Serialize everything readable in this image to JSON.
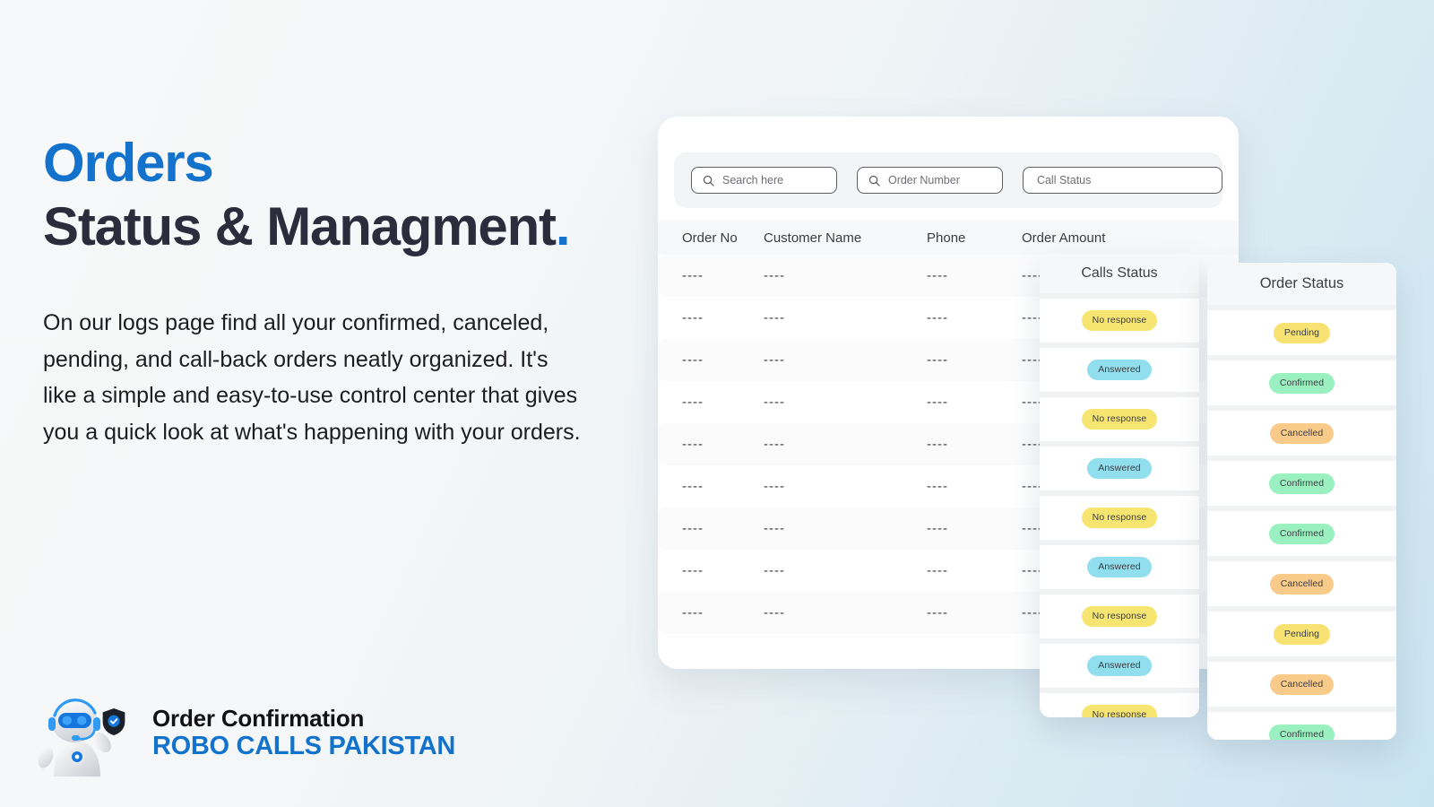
{
  "hero": {
    "headline_line1": "Orders",
    "headline_line2": "Status & Managment",
    "headline_dot": ".",
    "paragraph": "On our logs page find all your confirmed, canceled, pending, and call-back orders neatly organized. It's like a simple and easy-to-use control center that gives you a quick look at what's happening with your orders."
  },
  "brand": {
    "title": "Order Confirmation",
    "subtitle": "ROBO CALLS PAKISTAN",
    "mascot_icon": "robot-mascot-icon",
    "shield_icon": "shield-check-icon"
  },
  "colors": {
    "accent_blue": "#1272cc",
    "headline_dark": "#2b2d3c",
    "badge_yellow": "#f7e572",
    "badge_cyan": "#91dfee",
    "badge_green": "#9bf0bf",
    "badge_orange": "#f9cb8a",
    "card_white": "#ffffff",
    "bg_left": "#f7f8f9",
    "bg_right": "#c9e3f0"
  },
  "orders_panel": {
    "filters": [
      {
        "name": "search",
        "placeholder": "Search here",
        "value": "",
        "icon": "search-icon"
      },
      {
        "name": "order-number",
        "placeholder": "Order Number",
        "value": "",
        "icon": "search-icon"
      },
      {
        "name": "call-status",
        "placeholder": "Call Status",
        "value": "",
        "icon": ""
      }
    ],
    "columns": [
      "Order No",
      "Customer Name",
      "Phone",
      "Order Amount"
    ],
    "placeholder_cell": "----",
    "rows": [
      {
        "order_no": "----",
        "customer_name": "----",
        "phone": "----",
        "order_amount": "----"
      },
      {
        "order_no": "----",
        "customer_name": "----",
        "phone": "----",
        "order_amount": "----"
      },
      {
        "order_no": "----",
        "customer_name": "----",
        "phone": "----",
        "order_amount": "----"
      },
      {
        "order_no": "----",
        "customer_name": "----",
        "phone": "----",
        "order_amount": "----"
      },
      {
        "order_no": "----",
        "customer_name": "----",
        "phone": "----",
        "order_amount": "----"
      },
      {
        "order_no": "----",
        "customer_name": "----",
        "phone": "----",
        "order_amount": "----"
      },
      {
        "order_no": "----",
        "customer_name": "----",
        "phone": "----",
        "order_amount": "----"
      },
      {
        "order_no": "----",
        "customer_name": "----",
        "phone": "----",
        "order_amount": "----"
      },
      {
        "order_no": "----",
        "customer_name": "----",
        "phone": "----",
        "order_amount": "----"
      }
    ]
  },
  "calls_status_panel": {
    "title": "Calls Status",
    "items": [
      {
        "label": "No response",
        "variant": "noresponse"
      },
      {
        "label": "Answered",
        "variant": "answered"
      },
      {
        "label": "No response",
        "variant": "noresponse"
      },
      {
        "label": "Answered",
        "variant": "answered"
      },
      {
        "label": "No response",
        "variant": "noresponse"
      },
      {
        "label": "Answered",
        "variant": "answered"
      },
      {
        "label": "No response",
        "variant": "noresponse"
      },
      {
        "label": "Answered",
        "variant": "answered"
      },
      {
        "label": "No response",
        "variant": "noresponse"
      }
    ]
  },
  "order_status_panel": {
    "title": "Order Status",
    "items": [
      {
        "label": "Pending",
        "variant": "pending"
      },
      {
        "label": "Confirmed",
        "variant": "confirmed"
      },
      {
        "label": "Cancelled",
        "variant": "cancelled"
      },
      {
        "label": "Confirmed",
        "variant": "confirmed"
      },
      {
        "label": "Confirmed",
        "variant": "confirmed"
      },
      {
        "label": "Cancelled",
        "variant": "cancelled"
      },
      {
        "label": "Pending",
        "variant": "pending"
      },
      {
        "label": "Cancelled",
        "variant": "cancelled"
      },
      {
        "label": "Confirmed",
        "variant": "confirmed"
      }
    ]
  }
}
